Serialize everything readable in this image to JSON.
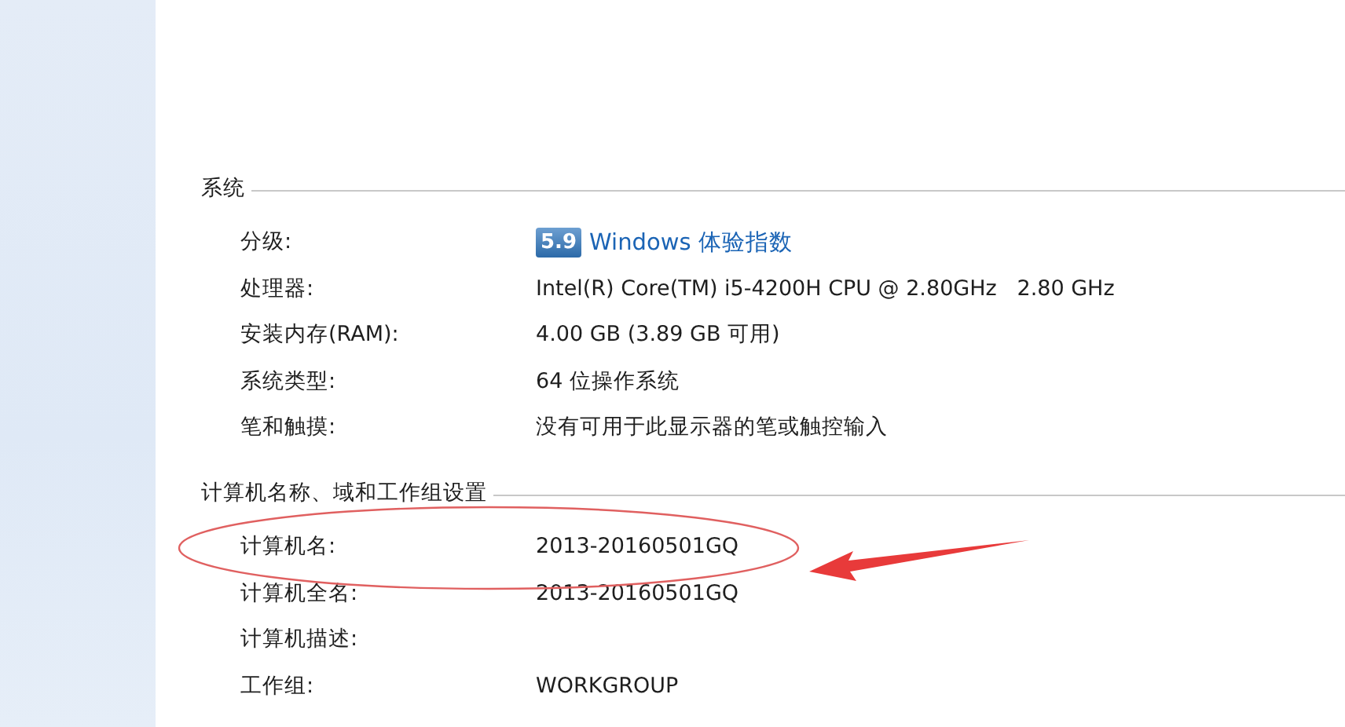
{
  "sections": [
    {
      "title": "系统",
      "rows": [
        {
          "kind": "rating",
          "label": "分级:",
          "score": "5.9",
          "value": "Windows 体验指数"
        },
        {
          "kind": "text",
          "label": "处理器:",
          "value": "Intel(R) Core(TM) i5-4200H CPU @ 2.80GHz   2.80 GHz"
        },
        {
          "kind": "text",
          "label": "安装内存(RAM):",
          "value": "4.00 GB (3.89 GB 可用)"
        },
        {
          "kind": "text",
          "label": "系统类型:",
          "value": "64 位操作系统"
        },
        {
          "kind": "text",
          "label": "笔和触摸:",
          "value": "没有可用于此显示器的笔或触控输入"
        }
      ]
    },
    {
      "title": "计算机名称、域和工作组设置",
      "rows": [
        {
          "kind": "text",
          "label": "计算机名:",
          "value": "2013-20160501GQ"
        },
        {
          "kind": "text",
          "label": "计算机全名:",
          "value": "2013-20160501GQ"
        },
        {
          "kind": "text",
          "label": "计算机描述:"
        },
        {
          "kind": "text",
          "label": "工作组:",
          "value": "WORKGROUP"
        }
      ]
    }
  ]
}
